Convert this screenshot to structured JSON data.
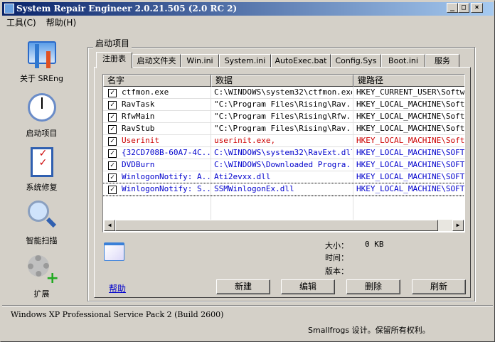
{
  "window": {
    "title": "System Repair Engineer 2.0.21.505 (2.0 RC 2)"
  },
  "menu": [
    "工具(C)",
    "帮助(H)"
  ],
  "sidebar": [
    {
      "label": "关于 SREng",
      "icon": "tools-icon"
    },
    {
      "label": "启动项目",
      "icon": "clock-icon"
    },
    {
      "label": "系统修复",
      "icon": "checklist-icon"
    },
    {
      "label": "智能扫描",
      "icon": "magnifier-icon"
    },
    {
      "label": "扩展",
      "icon": "gear-plus-icon"
    }
  ],
  "group_title": "启动项目",
  "tabs": [
    "注册表",
    "启动文件夹",
    "Win.ini",
    "System.ini",
    "AutoExec.bat",
    "Config.Sys",
    "Boot.ini",
    "服务"
  ],
  "active_tab": "注册表",
  "columns": [
    "名字",
    "数据",
    "键路径"
  ],
  "rows": [
    {
      "name": "ctfmon.exe",
      "data": "C:\\WINDOWS\\system32\\ctfmon.exe",
      "key": "HKEY_CURRENT_USER\\Softwar",
      "color": "#000000",
      "checked": true
    },
    {
      "name": "RavTask",
      "data": "\"C:\\Program Files\\Rising\\Rav...",
      "key": "HKEY_LOCAL_MACHINE\\Softwa",
      "color": "#000000",
      "checked": true
    },
    {
      "name": "RfwMain",
      "data": "\"C:\\Program Files\\Rising\\Rfw...",
      "key": "HKEY_LOCAL_MACHINE\\Softwa",
      "color": "#000000",
      "checked": true
    },
    {
      "name": "RavStub",
      "data": "\"C:\\Program Files\\Rising\\Rav...",
      "key": "HKEY_LOCAL_MACHINE\\Softwa",
      "color": "#000000",
      "checked": true
    },
    {
      "name": "Userinit",
      "data": "userinit.exe,",
      "key": "HKEY_LOCAL_MACHINE\\Softwa",
      "color": "#cc0000",
      "checked": true
    },
    {
      "name": "{32CD708B-60A7-4C...",
      "data": "C:\\WINDOWS\\system32\\RavExt.dll",
      "key": "HKEY_LOCAL_MACHINE\\SOFTWA",
      "color": "#0000cc",
      "checked": true
    },
    {
      "name": "DVDBurn",
      "data": "C:\\WINDOWS\\Downloaded Progra...",
      "key": "HKEY_LOCAL_MACHINE\\SOFTWA",
      "color": "#0000cc",
      "checked": true
    },
    {
      "name": "WinlogonNotify: A...",
      "data": "Ati2evxx.dll",
      "key": "HKEY_LOCAL_MACHINE\\SOFTWA",
      "color": "#0000cc",
      "checked": true
    },
    {
      "name": "WinlogonNotify: S...",
      "data": "SSMWinlogonEx.dll",
      "key": "HKEY_LOCAL_MACHINE\\SOFTWA",
      "color": "#0000cc",
      "checked": true
    }
  ],
  "info": {
    "size_label": "大小：",
    "size_value": "0 KB",
    "time_label": "时间：",
    "version_label": "版本："
  },
  "help_link": "帮助",
  "buttons": {
    "new": "新建",
    "edit": "编辑",
    "delete": "删除",
    "refresh": "刷新"
  },
  "status": {
    "os": "Windows XP Professional Service Pack 2 (Build 2600)",
    "credit": "Smallfrogs 设计。保留所有权利。"
  }
}
